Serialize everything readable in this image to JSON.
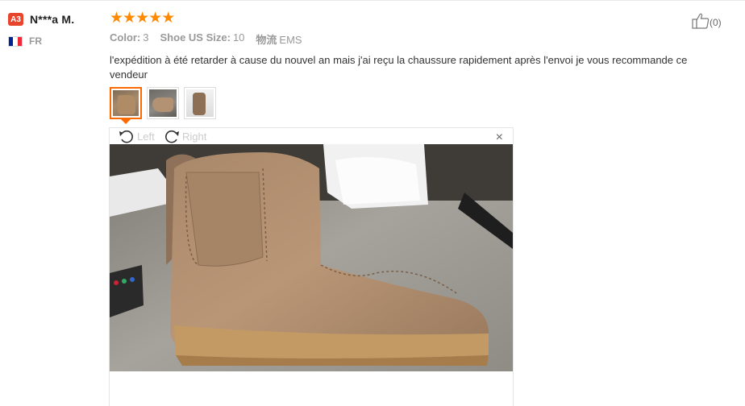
{
  "reviewer": {
    "level": "A3",
    "name": "N***a M.",
    "country": "FR",
    "flag_colors": [
      "#002395",
      "#ffffff",
      "#ed2939"
    ]
  },
  "rating": {
    "stars": 5,
    "max": 5,
    "star_glyph": "★",
    "color": "#ff8a00"
  },
  "attributes": [
    {
      "key": "Color:",
      "value": "3"
    },
    {
      "key": "Shoe US Size:",
      "value": "10"
    },
    {
      "key": "物流",
      "value": "EMS"
    }
  ],
  "review_text": "l'expédition à été retarder à cause du nouvel an mais j'ai reçu la chaussure rapidement après l'envoi je vous recommande ce vendeur",
  "helpful": {
    "icon": "thumbs-up-icon",
    "count": "(0)"
  },
  "thumbnails": [
    {
      "icon": "photo-thumbnail-1",
      "active": true
    },
    {
      "icon": "photo-thumbnail-2",
      "active": false
    },
    {
      "icon": "photo-thumbnail-3",
      "active": false
    }
  ],
  "viewer": {
    "rotate_left_label": "Left",
    "rotate_right_label": "Right",
    "close_glyph": "×"
  },
  "colors": {
    "accent": "#ff6a00",
    "badge": "#e8452f"
  }
}
